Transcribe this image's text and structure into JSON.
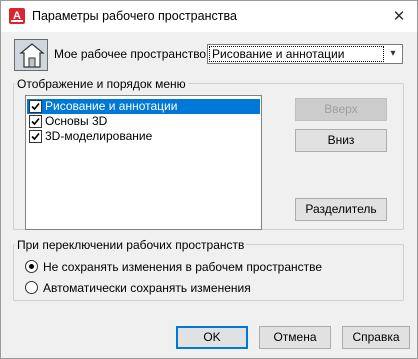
{
  "window": {
    "title": "Параметры рабочего пространства",
    "close_glyph": "✕"
  },
  "workspace": {
    "label": "Мое рабочее пространство =",
    "selected": "Рисование и аннотации",
    "dropdown_glyph": "▾"
  },
  "display_group": {
    "title": "Отображение и порядок меню",
    "items": [
      {
        "label": "Рисование и аннотации",
        "checked": true,
        "selected": true
      },
      {
        "label": "Основы 3D",
        "checked": true,
        "selected": false
      },
      {
        "label": "3D-моделирование",
        "checked": true,
        "selected": false
      }
    ],
    "up_button": "Вверх",
    "down_button": "Вниз",
    "separator_button": "Разделитель"
  },
  "switch_group": {
    "title": "При переключении рабочих пространств",
    "options": [
      {
        "label": "Не сохранять изменения в рабочем пространстве",
        "checked": true
      },
      {
        "label": "Автоматически сохранять изменения",
        "checked": false
      }
    ]
  },
  "footer": {
    "ok": "OK",
    "cancel": "Отмена",
    "help": "Справка"
  },
  "colors": {
    "selection": "#0078d7",
    "app_icon": "#d9252f",
    "default_button_border": "#0078d7"
  }
}
